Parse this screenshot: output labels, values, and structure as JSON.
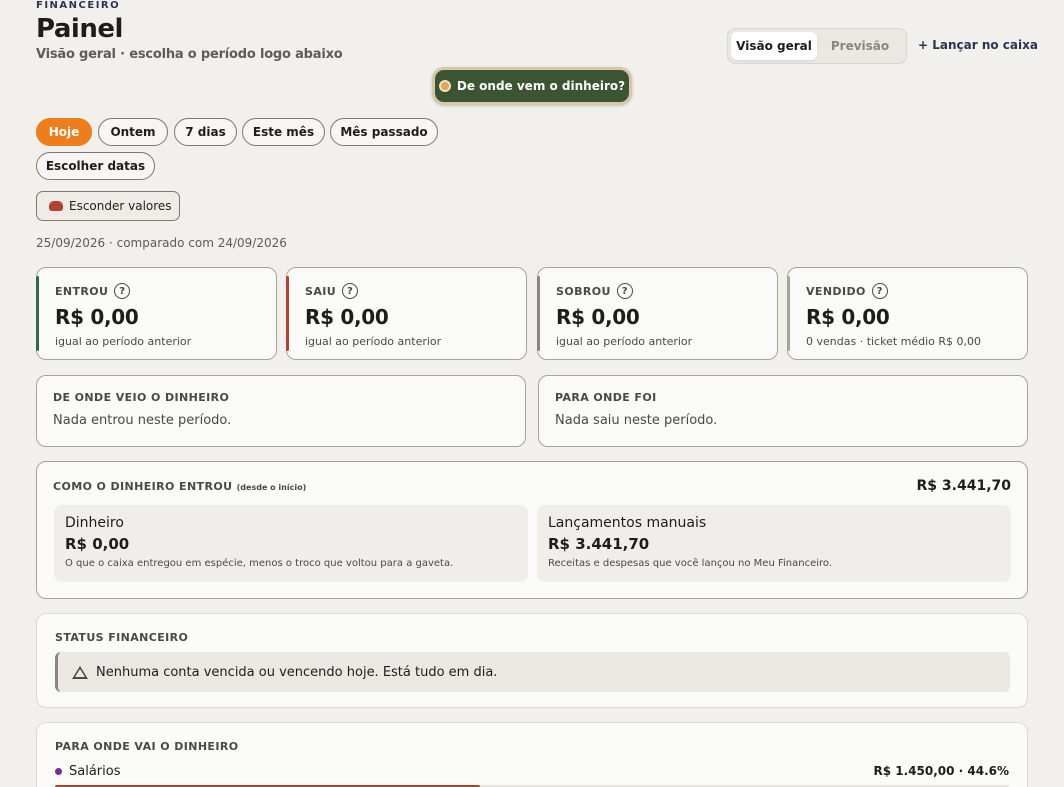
{
  "header": {
    "eyebrow": "FINANCEIRO",
    "title": "Painel",
    "subtitle": "Visão geral · escolha o período logo abaixo"
  },
  "view_toggle": {
    "options": [
      "Visão geral",
      "Previsão"
    ],
    "active": "Visão geral"
  },
  "launch_link": "+ Lançar no caixa",
  "help_button": {
    "label": "De onde vem o dinheiro?",
    "icon": "compass-icon"
  },
  "period_chips": [
    "Hoje",
    "Ontem",
    "7 dias",
    "Este mês",
    "Mês passado",
    "Escolher datas"
  ],
  "active_chip": "Hoje",
  "hide_values": {
    "label": "Esconder valores",
    "icon": "incognito-icon"
  },
  "period_text": "25/09/2026 · comparado com 24/09/2026",
  "kpis": [
    {
      "label": "ENTROU",
      "value": "R$ 0,00",
      "note": "igual ao período anterior",
      "color": "#2f6b4a"
    },
    {
      "label": "SAIU",
      "value": "R$ 0,00",
      "note": "igual ao período anterior",
      "color": "#b3412f"
    },
    {
      "label": "SOBROU",
      "value": "R$ 0,00",
      "note": "igual ao período anterior",
      "color": "#8a8580"
    },
    {
      "label": "VENDIDO",
      "value": "R$ 0,00",
      "note": "0 vendas · ticket médio R$ 0,00",
      "color": "#a7a39f"
    }
  ],
  "help_glyph": "?",
  "sources": {
    "label": "DE ONDE VEIO O DINHEIRO",
    "text": "Nada entrou neste período."
  },
  "destinations": {
    "label": "PARA ONDE FOI",
    "text": "Nada saiu neste período."
  },
  "entry": {
    "label": "COMO O DINHEIRO ENTROU",
    "label_note": "(desde o início)",
    "total": "R$ 3.441,70",
    "items": [
      {
        "title": "Dinheiro",
        "value": "R$ 0,00",
        "desc": "O que o caixa entregou em espécie, menos o troco que voltou para a gaveta."
      },
      {
        "title": "Lançamentos manuais",
        "value": "R$ 3.441,70",
        "desc": "Receitas e despesas que você lançou no Meu Financeiro."
      }
    ]
  },
  "status": {
    "label": "STATUS FINANCEIRO",
    "alert": "Nenhuma conta vencida ou vencendo hoje. Está tudo em dia.",
    "icon": "warning-icon"
  },
  "spending": {
    "label": "PARA ONDE VAI O DINHEIRO",
    "rows": [
      {
        "name": "Salários",
        "amount": "R$ 1.450,00 · 44.6%",
        "share": 0.446,
        "color": "#7b2c8f"
      }
    ]
  }
}
